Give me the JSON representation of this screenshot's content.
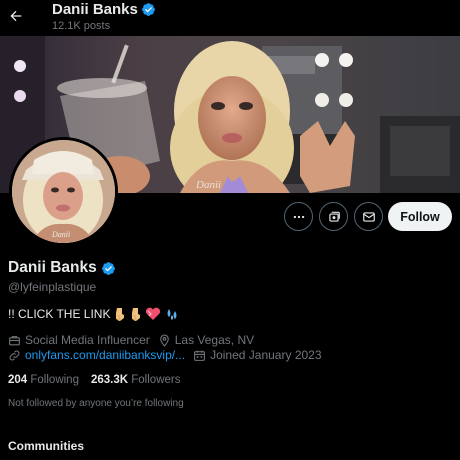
{
  "header": {
    "name": "Danii Banks",
    "posts": "12.1K posts"
  },
  "profile": {
    "display_name": "Danii Banks",
    "handle": "@lyfeinplastique",
    "bio_text": "!! CLICK THE LINK",
    "bio_emojis": [
      "finger-down",
      "finger-down",
      "heart",
      "droplets"
    ],
    "category": "Social Media Influencer",
    "location": "Las Vegas, NV",
    "link": "onlyfans.com/daniibanksvip/...",
    "joined": "Joined January 2023",
    "following_count": "204",
    "following_label": "Following",
    "followers_count": "263.3K",
    "followers_label": "Followers",
    "not_followed_text": "Not followed by anyone you’re following",
    "verified_color": "#1d9bf0"
  },
  "actions": {
    "follow_label": "Follow"
  },
  "sections": {
    "communities_label": "Communities"
  },
  "banner": {
    "image_text": "Danii"
  },
  "avatar": {
    "image_text": "Danii"
  },
  "colors": {
    "accent": "#1d9bf0",
    "background": "#000000",
    "muted": "#71767b"
  }
}
